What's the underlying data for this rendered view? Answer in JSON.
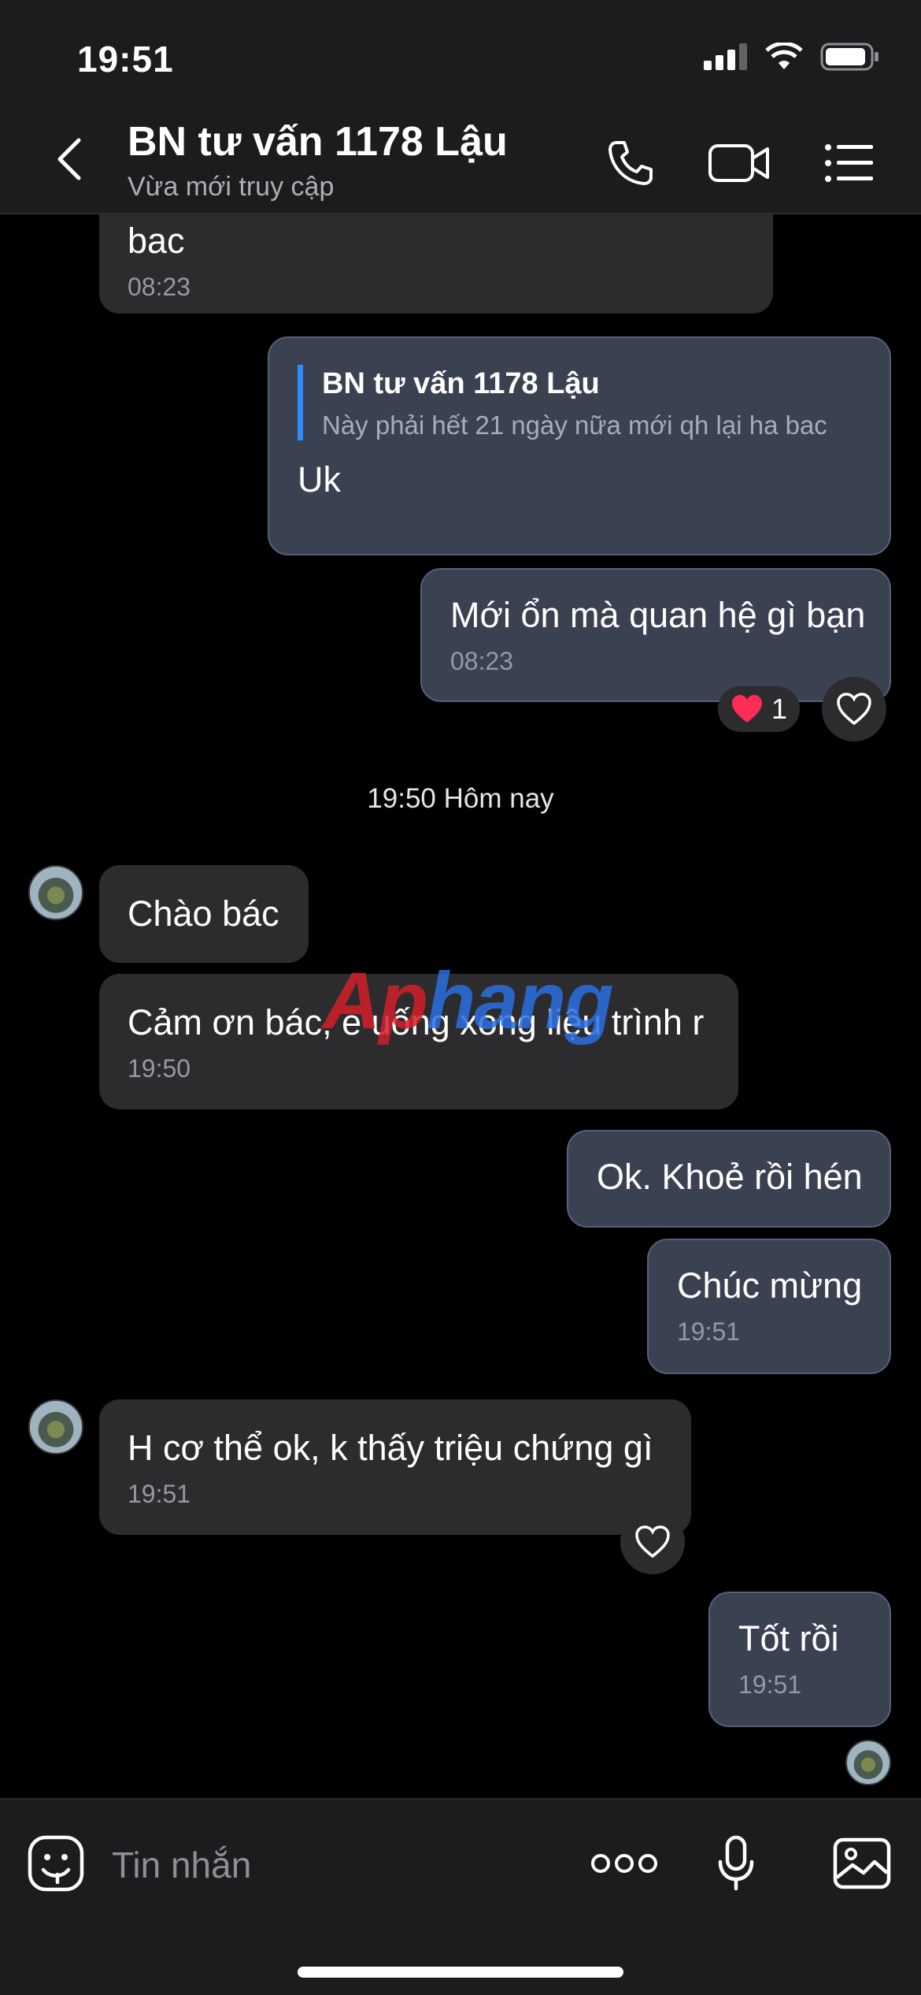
{
  "status_bar": {
    "time": "19:51"
  },
  "header": {
    "title": "BN tư vấn 1178 Lậu",
    "subtitle": "Vừa mới truy cập",
    "icons": [
      "back-chevron-icon",
      "phone-icon",
      "video-icon",
      "menu-list-icon"
    ]
  },
  "messages": {
    "m0": {
      "text": "bac",
      "time": "08:23"
    },
    "m1": {
      "quote_author": "BN tư vấn 1178 Lậu",
      "quote_text": "Này phải hết 21 ngày nữa mới qh lại ha bac",
      "text": "Uk"
    },
    "m2": {
      "text": "Mới ổn mà quan hệ gì bạn",
      "time": "08:23",
      "reaction_count": "1"
    },
    "divider": "19:50 Hôm nay",
    "m3": {
      "text": "Chào bác"
    },
    "m4": {
      "text": "Cảm ơn bác, e uống xong liệu trình r",
      "time": "19:50"
    },
    "m5": {
      "text": "Ok. Khoẻ rồi hén"
    },
    "m6": {
      "text": "Chúc mừng",
      "time": "19:51"
    },
    "m7": {
      "text": "H cơ thể ok, k thấy triệu chứng gì",
      "time": "19:51"
    },
    "m8": {
      "text": "Tốt rồi",
      "time": "19:51"
    }
  },
  "watermark": {
    "part1": "Ap",
    "part2": "hang"
  },
  "input": {
    "placeholder": "Tin nhắn"
  },
  "colors": {
    "outgoing_bubble": "#3a4150",
    "incoming_bubble": "#2c2c2e",
    "quote_bar": "#2f8cff",
    "heart": "#ff2d55"
  }
}
